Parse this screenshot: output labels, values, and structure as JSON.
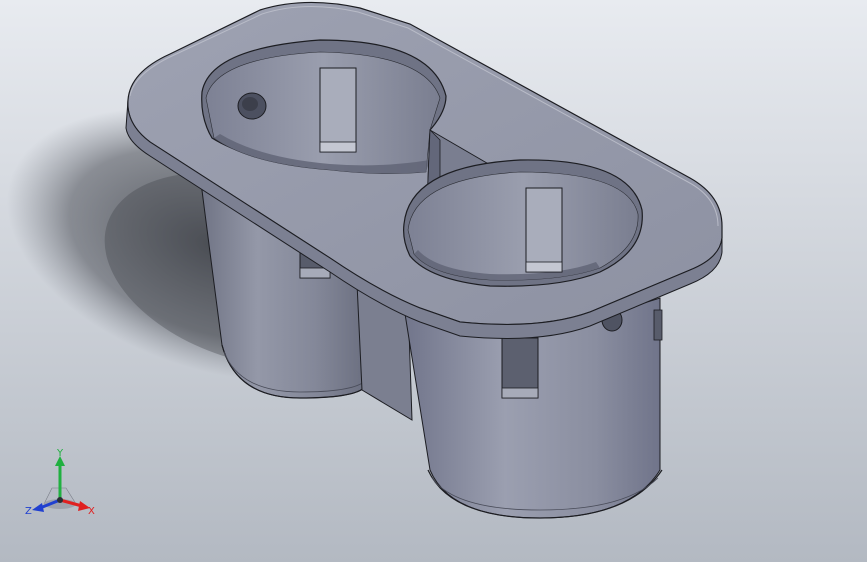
{
  "viewport": {
    "background_top": "#e8ebf0",
    "background_bottom": "#b3b9c2",
    "part_color": "#8e93a2",
    "part_highlight": "#a6aab8",
    "part_shadow": "#5c6070",
    "edge_color": "#1c1d22"
  },
  "triad": {
    "x_label": "X",
    "y_label": "Y",
    "z_label": "Z",
    "x_color": "#e02020",
    "y_color": "#20b040",
    "z_color": "#2040d0"
  }
}
